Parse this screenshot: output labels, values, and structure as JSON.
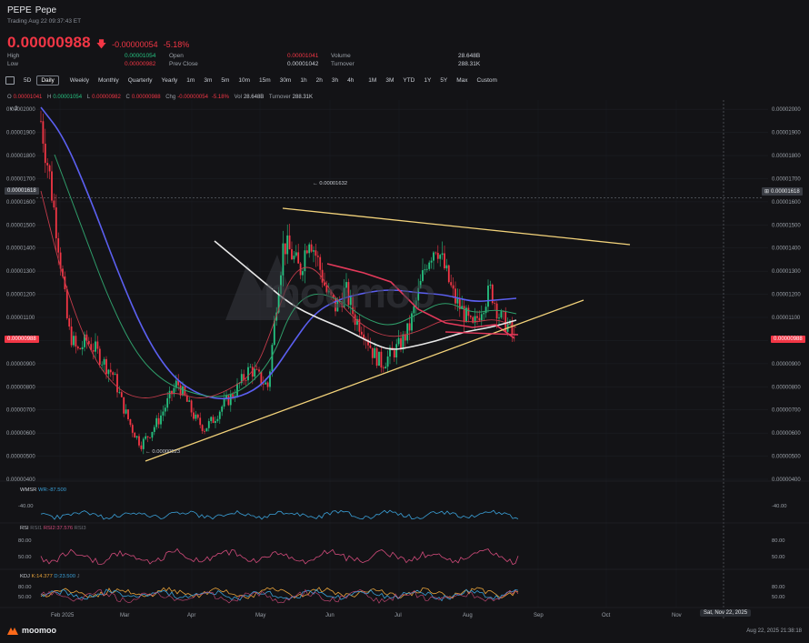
{
  "header": {
    "symbol": "PEPE",
    "name": "Pepe",
    "trading_status": "Trading Aug 22 09:37:43 ET",
    "price": "0.00000988",
    "change": "-0.00000054",
    "change_pct": "-5.18%"
  },
  "stats": {
    "high_label": "High",
    "high": "0.00001054",
    "low_label": "Low",
    "low": "0.00000982",
    "open_label": "Open",
    "open": "0.00001041",
    "prev_close_label": "Prev Close",
    "prev_close": "0.00001042",
    "volume_label": "Volume",
    "volume": "28.648B",
    "turnover_label": "Turnover",
    "turnover": "288.31K"
  },
  "toolbar": {
    "items": [
      "5D",
      "Daily",
      "Weekly",
      "Monthly",
      "Quarterly",
      "Yearly",
      "1m",
      "3m",
      "5m",
      "10m",
      "15m",
      "30m",
      "1h",
      "2h",
      "3h",
      "4h",
      "1M",
      "3M",
      "YTD",
      "1Y",
      "5Y",
      "Max",
      "Custom"
    ],
    "active": "Daily"
  },
  "ohlc": {
    "o_label": "O",
    "o": "0.00001041",
    "h_label": "H",
    "h": "0.00001054",
    "l_label": "L",
    "l": "0.00000982",
    "c_label": "C",
    "c": "0.00000988",
    "chg_label": "Chg",
    "chg": "-0.00000054",
    "chg_pct": "-5.18%",
    "vol_label": "Vol",
    "vol": "28.648B",
    "turnover_label": "Turnover",
    "turnover": "288.31K"
  },
  "indicator_toggle": "2",
  "price_tags": {
    "crosshair": "0.00001618",
    "last": "0.00000988",
    "high_note": "0.00001632",
    "low_note": "0.00000523"
  },
  "indicators": {
    "wmsr": {
      "name": "WMSR",
      "wr_label": "WR:",
      "wr": "-87.500",
      "level": "-40.00"
    },
    "rsi": {
      "name": "RSI",
      "rsi1": "RSI1",
      "rsi2_label": "RSI2:",
      "rsi2": "37.576",
      "rsi3": "RSI3",
      "levels": [
        "80.00",
        "50.00"
      ]
    },
    "kdj": {
      "name": "KDJ",
      "k_label": "K:",
      "k": "14.377",
      "d_label": "D:",
      "d": "23.500",
      "j": "J",
      "levels": [
        "80.00",
        "50.00"
      ]
    }
  },
  "chart_data": {
    "type": "candlestick",
    "y_ticks": [
      "0.00002000",
      "0.00001900",
      "0.00001800",
      "0.00001700",
      "0.00001600",
      "0.00001500",
      "0.00001400",
      "0.00001300",
      "0.00001200",
      "0.00001100",
      "0.00001000",
      "0.00000900",
      "0.00000800",
      "0.00000700",
      "0.00000600",
      "0.00000500",
      "0.00000400"
    ],
    "ylim": [
      4e-06,
      2.04e-05
    ],
    "x_ticks": [
      "Feb 2025",
      "Mar",
      "Apr",
      "May",
      "Jun",
      "Jul",
      "Aug",
      "Sep",
      "Oct",
      "Nov"
    ],
    "crosshair_date": "Sat, Nov 22, 2025",
    "watermark": "moomoo",
    "colors": {
      "up": "#26c281",
      "down": "#f23645",
      "ma_blue": "#5b5ff0",
      "ma_white": "#e8e8e8",
      "trend": "#f2d27a",
      "ma_green": "#2f9e6a"
    }
  },
  "footer": {
    "brand": "moomoo",
    "timestamp": "Aug 22, 2025 21:38:18"
  }
}
